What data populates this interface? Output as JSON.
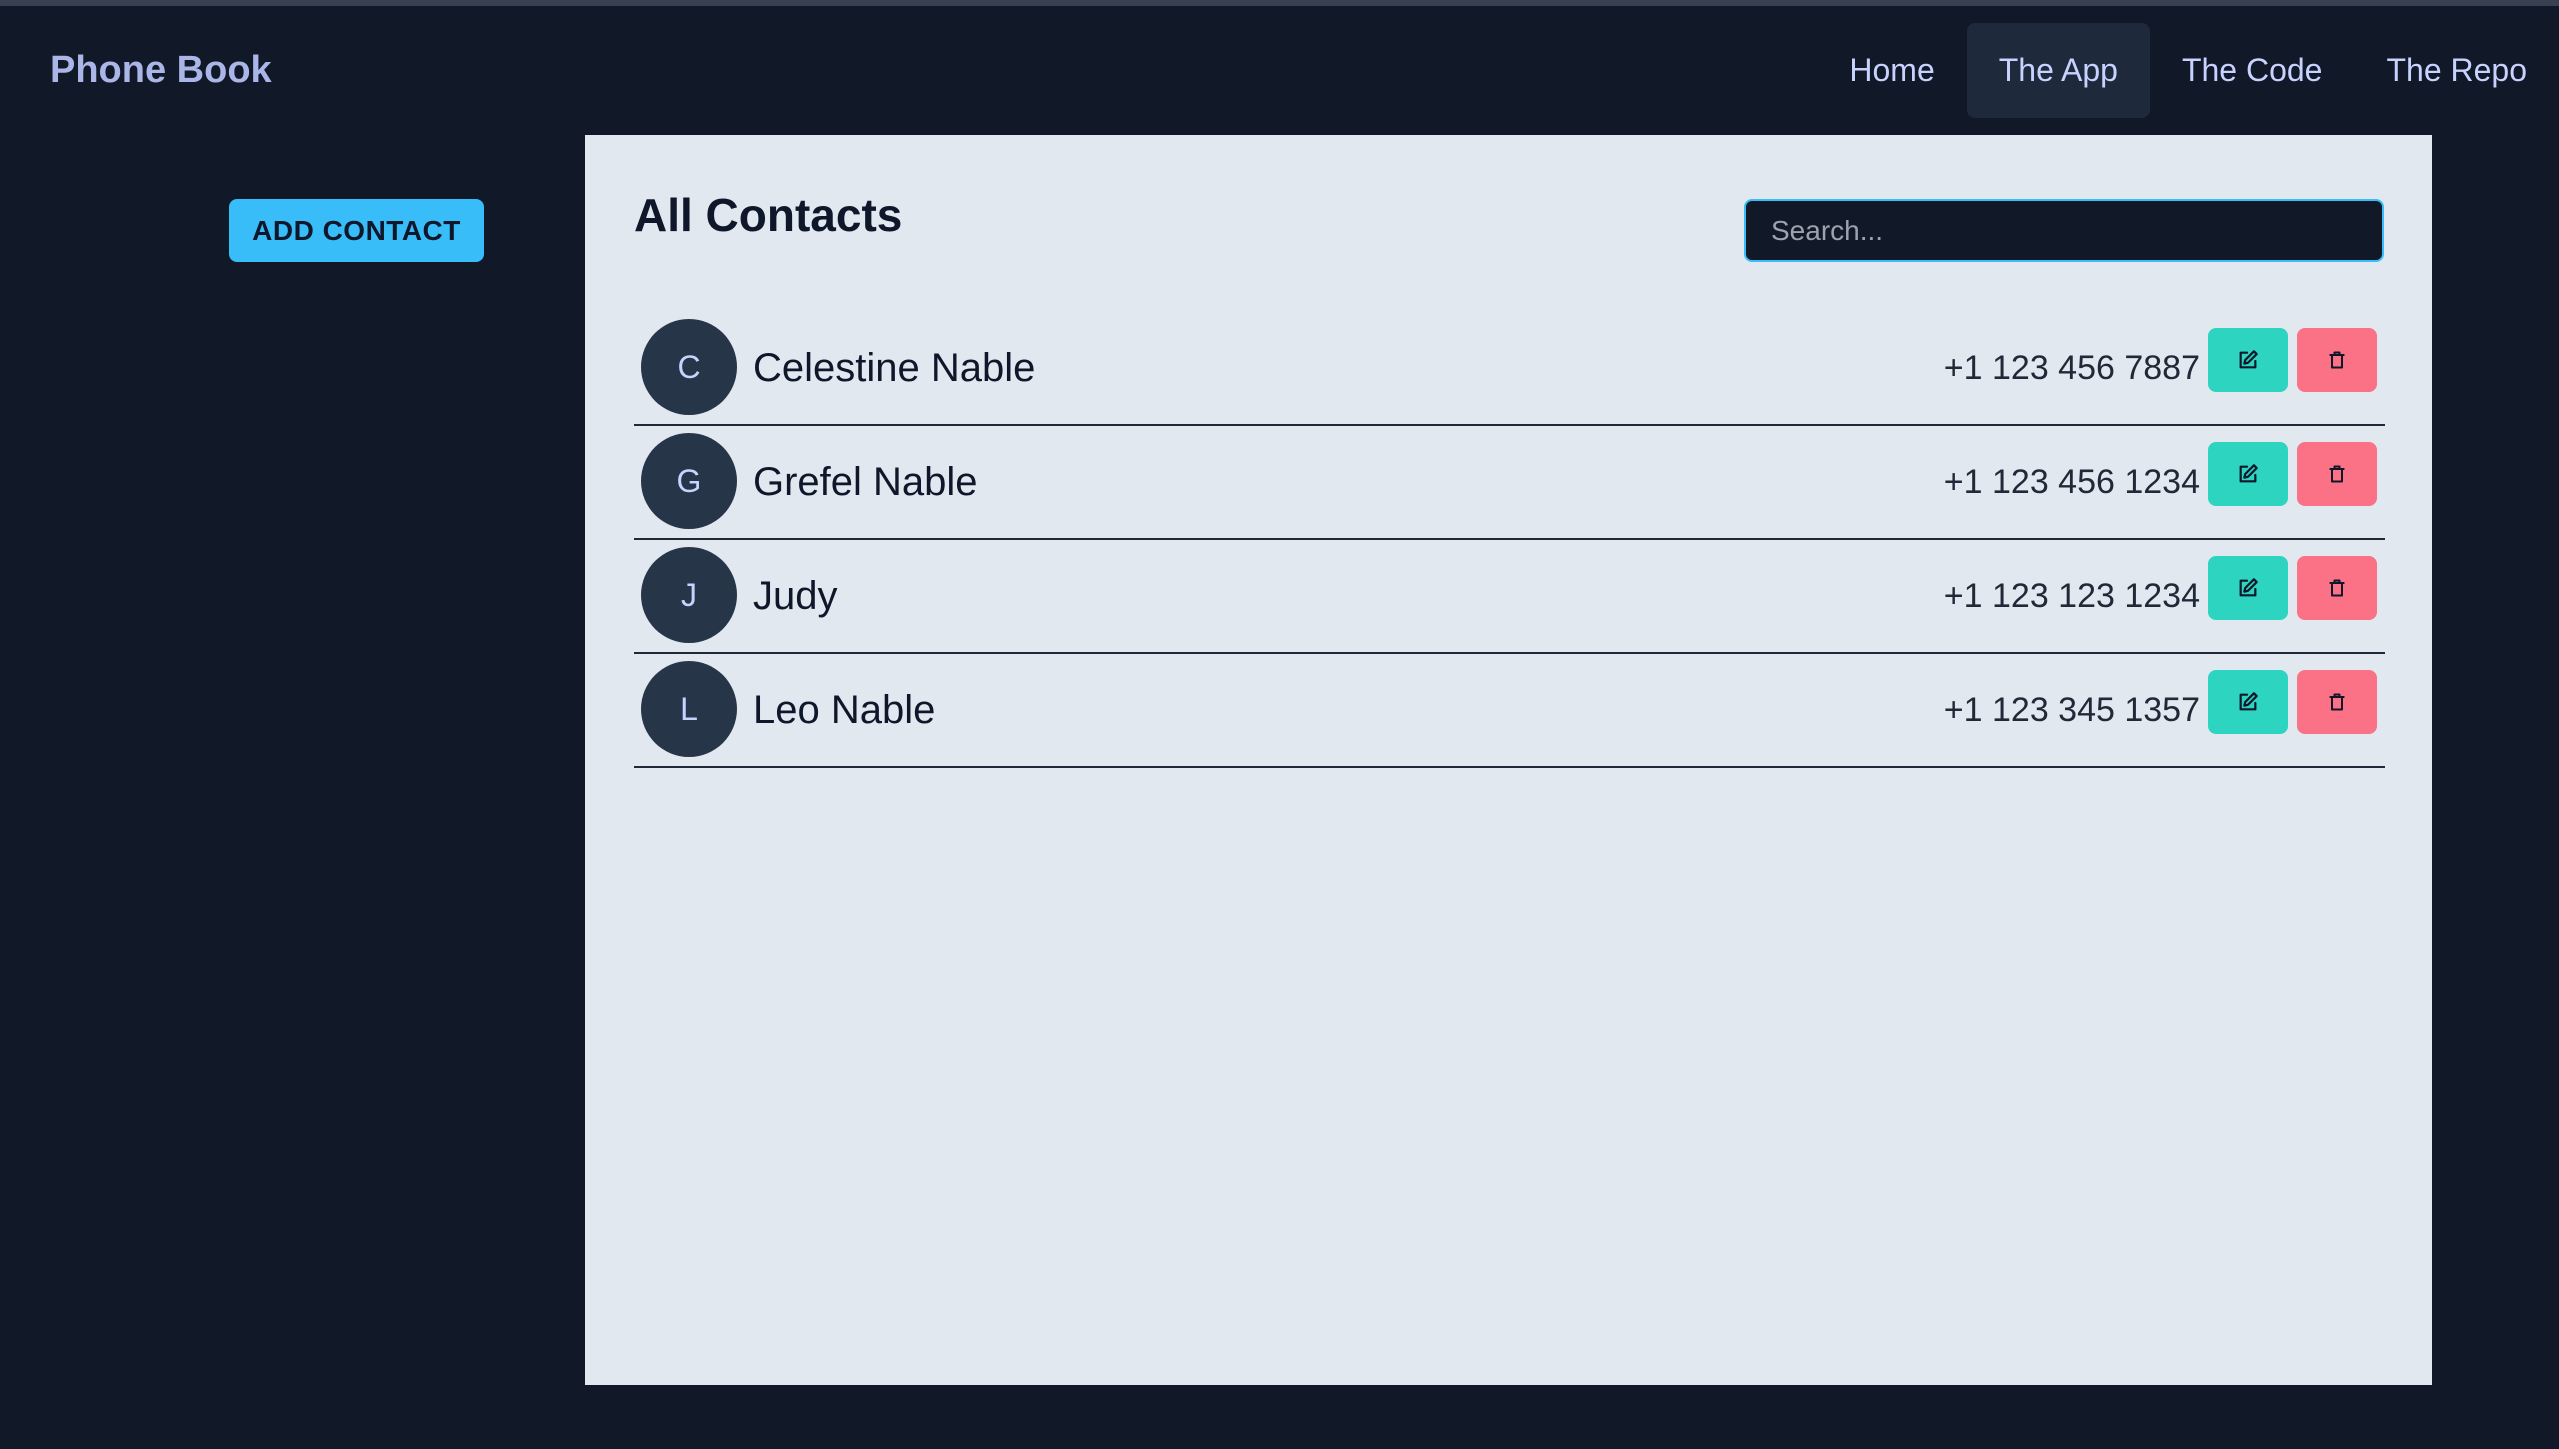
{
  "header": {
    "brand": "Phone Book",
    "nav": [
      {
        "label": "Home",
        "active": false
      },
      {
        "label": "The App",
        "active": true
      },
      {
        "label": "The Code",
        "active": false
      },
      {
        "label": "The Repo",
        "active": false
      }
    ]
  },
  "sidebar": {
    "add_contact_label": "ADD CONTACT"
  },
  "main": {
    "title": "All Contacts",
    "search": {
      "placeholder": "Search...",
      "value": ""
    },
    "contacts": [
      {
        "initial": "C",
        "name": "Celestine Nable",
        "phone": "+1 123 456 7887"
      },
      {
        "initial": "G",
        "name": "Grefel Nable",
        "phone": "+1 123 456 1234"
      },
      {
        "initial": "J",
        "name": "Judy",
        "phone": "+1 123 123 1234"
      },
      {
        "initial": "L",
        "name": "Leo Nable",
        "phone": "+1 123 345 1357"
      }
    ]
  },
  "icons": {
    "edit": "edit-icon",
    "delete": "trash-icon"
  },
  "colors": {
    "background": "#111827",
    "panel": "#e2e8f0",
    "accent": "#38bdf8",
    "edit": "#2dd4bf",
    "delete": "#fb7185",
    "avatar": "#273548"
  }
}
